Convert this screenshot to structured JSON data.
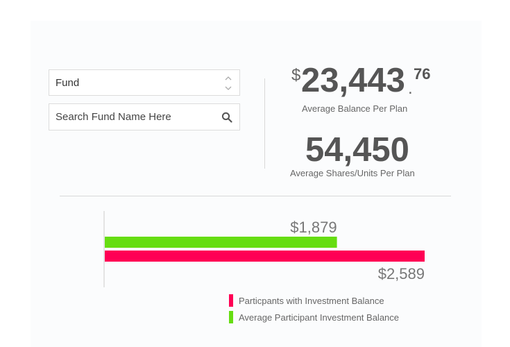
{
  "filters": {
    "fund_select": {
      "value": "Fund"
    },
    "search": {
      "placeholder": "Search Fund Name Here"
    }
  },
  "stats": {
    "average_balance": {
      "currency": "$",
      "whole": "23,443",
      "decimal_point": ".",
      "cents": "76",
      "label": "Average Balance Per Plan"
    },
    "average_shares": {
      "value": "54,450",
      "label": "Average Shares/Units Per Plan"
    }
  },
  "chart_data": {
    "type": "bar",
    "orientation": "horizontal",
    "title": "",
    "xlabel": "",
    "ylabel": "",
    "xlim": [
      0,
      2589
    ],
    "grid": false,
    "legend_position": "bottom",
    "series": [
      {
        "name": "Average Participant Investment Balance",
        "value": 1879,
        "label": "$1,879",
        "color": "#66dd11"
      },
      {
        "name": "Particpants with Investment Balance",
        "value": 2589,
        "label": "$2,589",
        "color": "#ff0055"
      }
    ]
  },
  "legend": [
    {
      "label": "Particpants with Investment Balance",
      "color": "#ff0055"
    },
    {
      "label": "Average Participant Investment Balance",
      "color": "#66dd11"
    }
  ],
  "icons": {
    "stepper": "chevron-up-down-icon",
    "search": "search-icon"
  }
}
